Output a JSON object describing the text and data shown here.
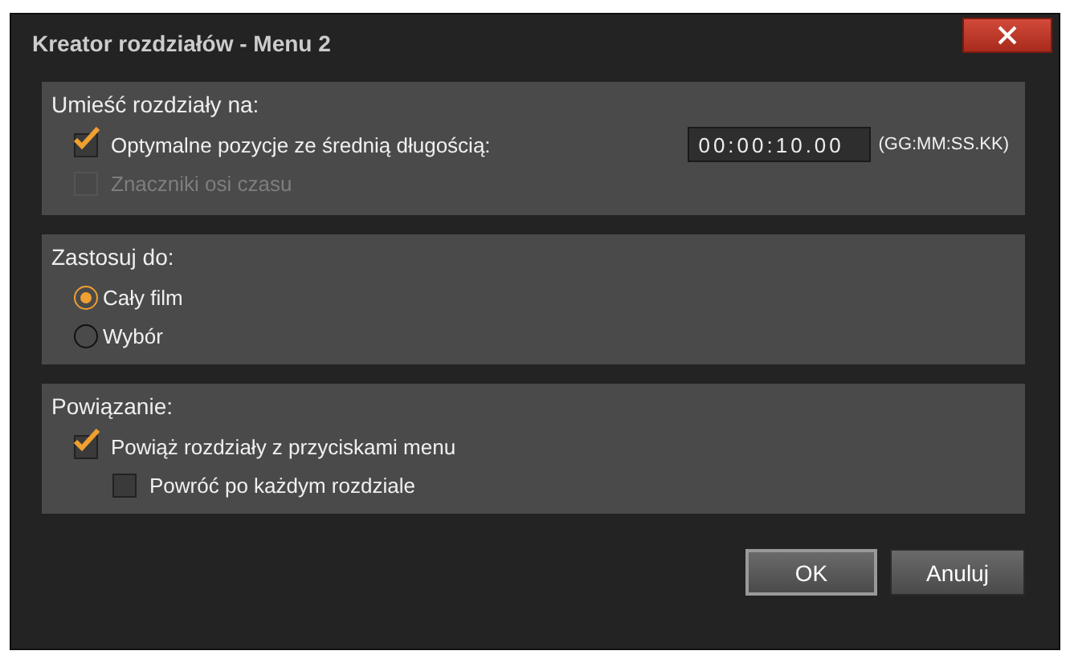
{
  "window": {
    "title": "Kreator rozdziałów - Menu 2"
  },
  "sections": [
    {
      "title": "Umieść rozdziały na:",
      "items": [
        {
          "kind": "checkbox",
          "label": "Optymalne pozycje ze średnią długością:",
          "checked": true,
          "disabled": false,
          "field": {
            "value": "00:00:10.00",
            "hint": "(GG:MM:SS.KK)"
          }
        },
        {
          "kind": "checkbox",
          "label": "Znaczniki osi czasu",
          "checked": false,
          "disabled": true
        }
      ]
    },
    {
      "title": "Zastosuj do:",
      "items": [
        {
          "kind": "radio",
          "label": "Cały film",
          "selected": true
        },
        {
          "kind": "radio",
          "label": "Wybór",
          "selected": false
        }
      ]
    },
    {
      "title": "Powiązanie:",
      "items": [
        {
          "kind": "checkbox",
          "label": "Powiąż rozdziały z przyciskami menu",
          "checked": true,
          "disabled": false,
          "children": [
            {
              "kind": "checkbox",
              "label": "Powróć po każdym rozdziale",
              "checked": false,
              "disabled": false
            }
          ]
        }
      ]
    }
  ],
  "buttons": [
    {
      "label": "OK",
      "default": true
    },
    {
      "label": "Anuluj",
      "default": false
    }
  ]
}
